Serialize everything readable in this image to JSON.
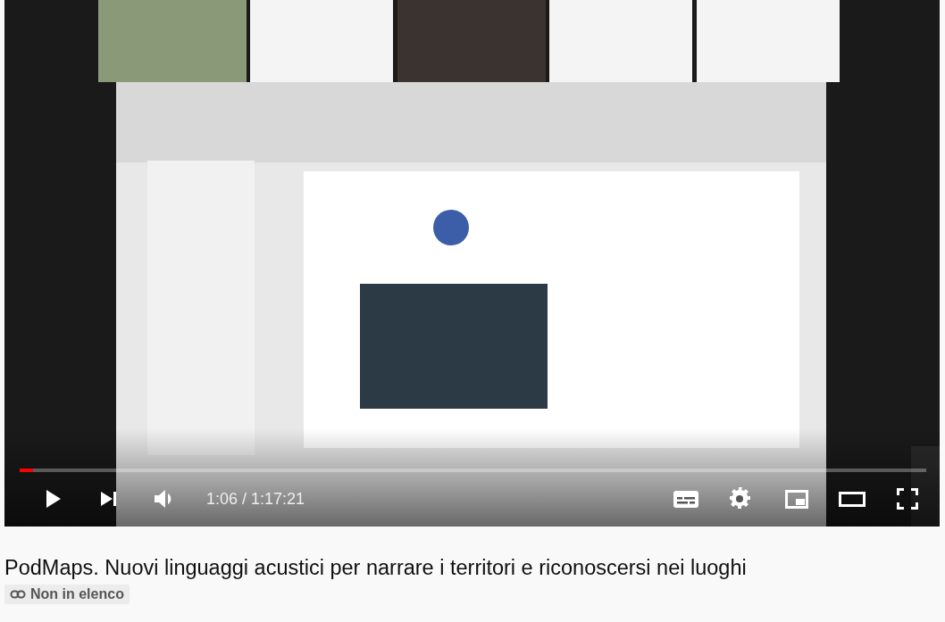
{
  "player": {
    "progress": {
      "level": 0.015
    },
    "time": "1:06 / 1:17:21"
  },
  "video_title": "PodMaps. Nuovi linguaggi acustici per narrare i territori e riconoscersi nei luoghi",
  "badge": {
    "label": "Non in elenco"
  }
}
